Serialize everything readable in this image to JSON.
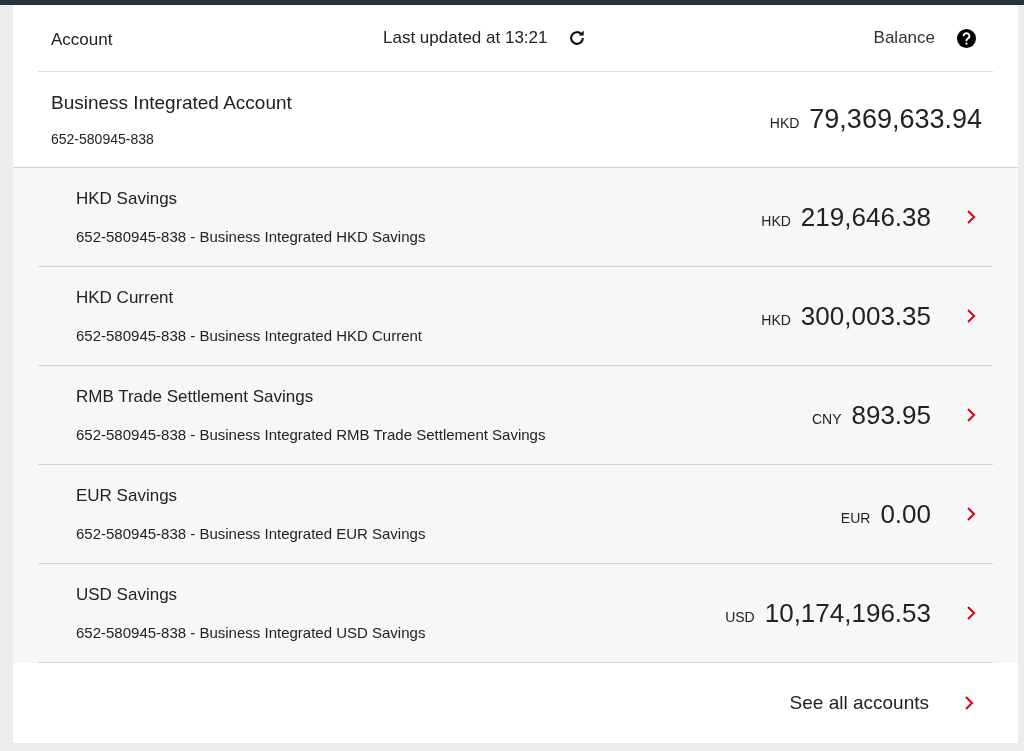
{
  "header": {
    "account_label": "Account",
    "last_updated": "Last updated at 13:21",
    "balance_label": "Balance"
  },
  "main_account": {
    "name": "Business Integrated Account",
    "number": "652-580945-838",
    "currency": "HKD",
    "amount": "79,369,633.94"
  },
  "sub_accounts": [
    {
      "name": "HKD Savings",
      "description": "652-580945-838 - Business Integrated HKD Savings",
      "currency": "HKD",
      "amount": "219,646.38"
    },
    {
      "name": "HKD Current",
      "description": "652-580945-838 - Business Integrated HKD Current",
      "currency": "HKD",
      "amount": "300,003.35"
    },
    {
      "name": "RMB Trade Settlement Savings",
      "description": "652-580945-838 - Business Integrated RMB Trade Settlement Savings",
      "currency": "CNY",
      "amount": "893.95"
    },
    {
      "name": "EUR Savings",
      "description": "652-580945-838 - Business Integrated EUR Savings",
      "currency": "EUR",
      "amount": "0.00"
    },
    {
      "name": "USD Savings",
      "description": "652-580945-838 - Business Integrated USD Savings",
      "currency": "USD",
      "amount": "10,174,196.53"
    }
  ],
  "footer": {
    "link": "See all accounts"
  }
}
